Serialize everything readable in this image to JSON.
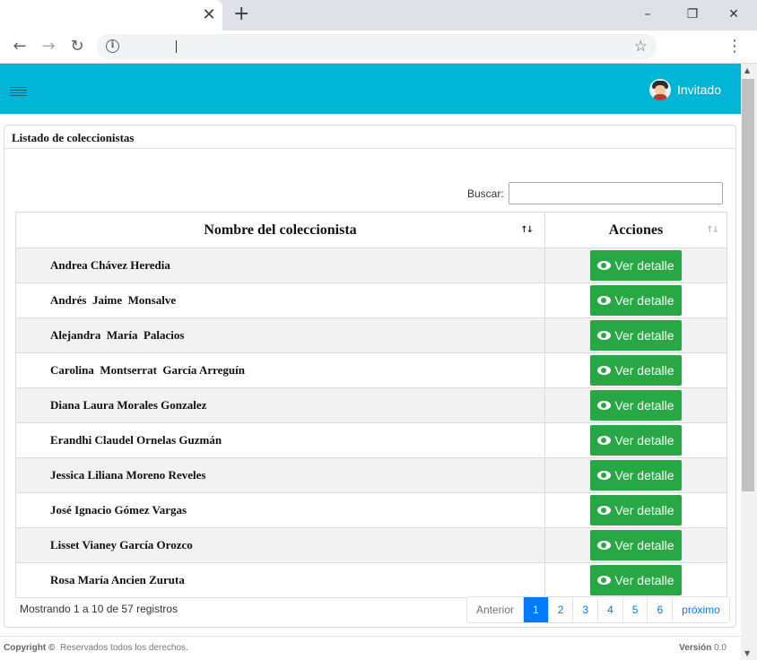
{
  "browser": {
    "tab_close": "✕",
    "new_tab": "+",
    "win_min": "–",
    "win_max": "❐",
    "win_close": "✕",
    "back": "←",
    "forward": "→",
    "reload": "↻",
    "info": "i",
    "bookmark": "☆",
    "menu": "⋮"
  },
  "header": {
    "user_name": "Invitado"
  },
  "card": {
    "title": "Listado de coleccionistas",
    "search_label": "Buscar:",
    "search_value": ""
  },
  "table": {
    "columns": [
      "Nombre del coleccionista",
      "Acciones"
    ],
    "action_label": "Ver detalle",
    "rows": [
      "Andrea Chávez Heredia",
      "Andrés  Jaime  Monsalve",
      "Alejandra  María  Palacios",
      "Carolina  Montserrat  García Arreguín",
      "Diana Laura Morales Gonzalez",
      "Erandhi Claudel Ornelas Guzmán",
      "Jessica Liliana Moreno Reveles",
      "José Ignacio Gómez Vargas",
      "Lisset Vianey García Orozco",
      "Rosa María Ancien Zuruta"
    ]
  },
  "pagination": {
    "info": "Mostrando 1 a 10 de 57 registros",
    "previous": "Anterior",
    "pages": [
      "1",
      "2",
      "3",
      "4",
      "5",
      "6"
    ],
    "active_page": "1",
    "next": "próximo"
  },
  "footer": {
    "copyright_label": "Copyright ©",
    "rights": "Reservados todos los derechos.",
    "version_label": "Versión",
    "version_value": "0.0"
  },
  "colors": {
    "header": "#00b5d6",
    "button": "#28a745",
    "active_page": "#007bff"
  }
}
